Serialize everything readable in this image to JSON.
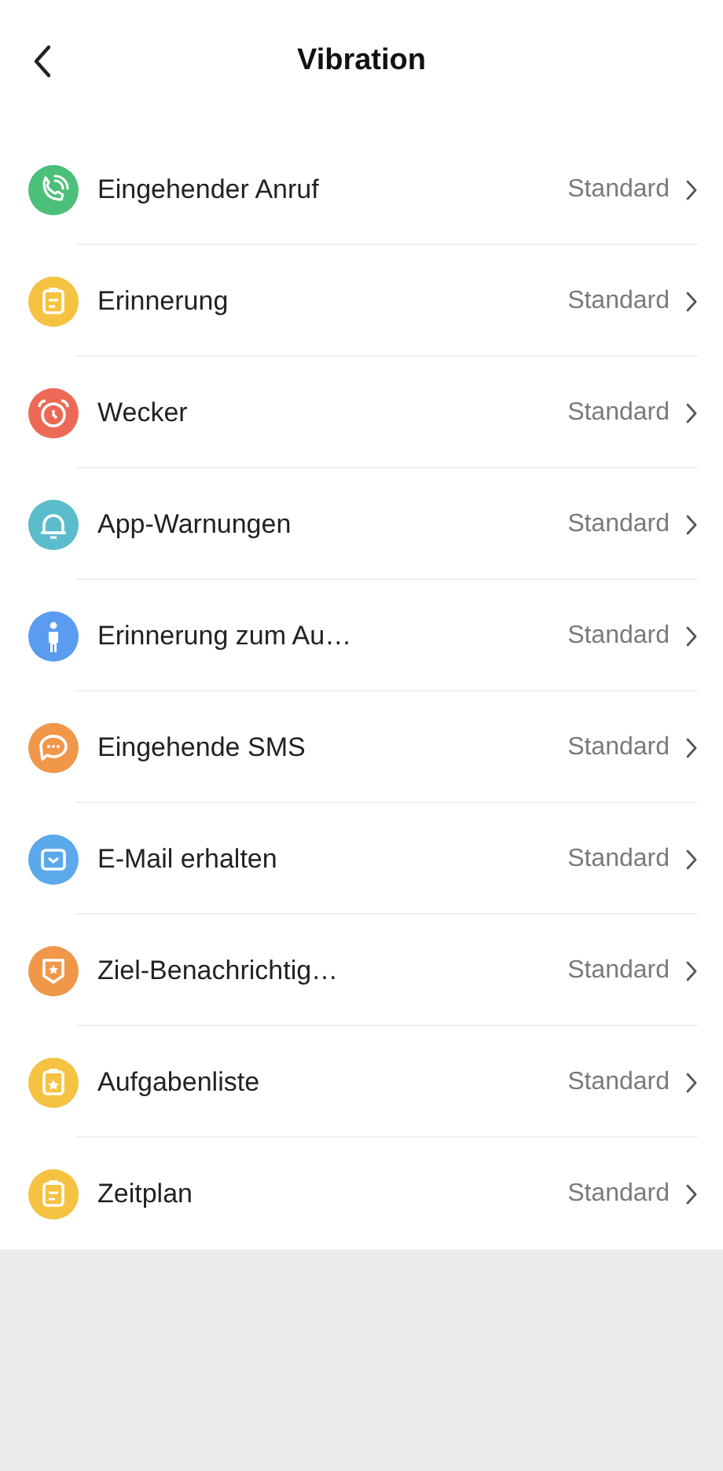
{
  "header": {
    "title": "Vibration"
  },
  "items": [
    {
      "label": "Eingehender Anruf",
      "value": "Standard",
      "kind": "phone",
      "color": "#4cbf7a"
    },
    {
      "label": "Erinnerung",
      "value": "Standard",
      "kind": "clipboard",
      "color": "#f5c242"
    },
    {
      "label": "Wecker",
      "value": "Standard",
      "kind": "alarm",
      "color": "#ec6a55"
    },
    {
      "label": "App-Warnungen",
      "value": "Standard",
      "kind": "bell",
      "color": "#5bbccc"
    },
    {
      "label": "Erinnerung zum Au…",
      "value": "Standard",
      "kind": "person",
      "color": "#5b9cf0"
    },
    {
      "label": "Eingehende SMS",
      "value": "Standard",
      "kind": "chat",
      "color": "#f0974a"
    },
    {
      "label": "E-Mail erhalten",
      "value": "Standard",
      "kind": "mail",
      "color": "#5ba8ea"
    },
    {
      "label": "Ziel-Benachrichtig…",
      "value": "Standard",
      "kind": "badge",
      "color": "#f0974a"
    },
    {
      "label": "Aufgabenliste",
      "value": "Standard",
      "kind": "clipboard-star",
      "color": "#f5c242"
    },
    {
      "label": "Zeitplan",
      "value": "Standard",
      "kind": "clipboard",
      "color": "#f5c242"
    }
  ]
}
